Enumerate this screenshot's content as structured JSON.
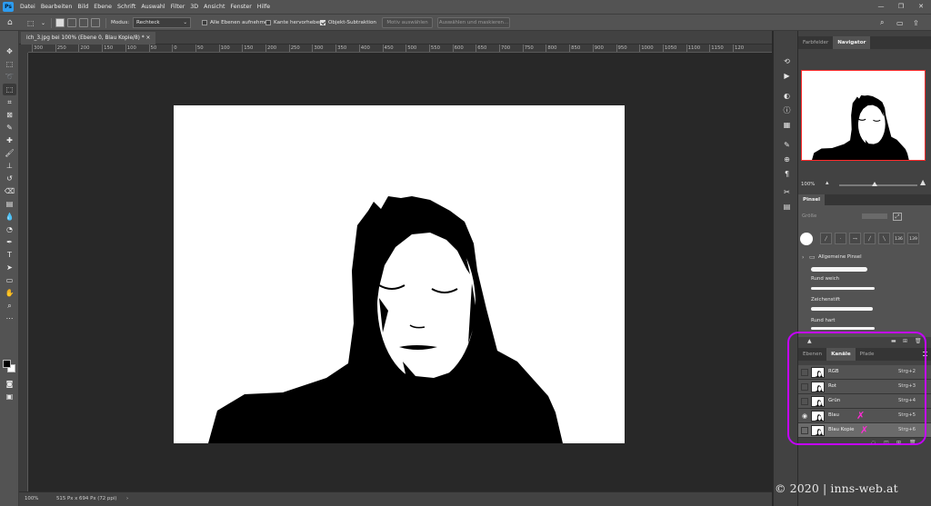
{
  "app": {
    "logo": "Ps"
  },
  "menu": [
    "Datei",
    "Bearbeiten",
    "Bild",
    "Ebene",
    "Schrift",
    "Auswahl",
    "Filter",
    "3D",
    "Ansicht",
    "Fenster",
    "Hilfe"
  ],
  "window_controls": [
    "—",
    "❐",
    "✕"
  ],
  "options_bar": {
    "mode_label": "Modus:",
    "mode_value": "Rechteck",
    "sample_all": "Alle Ebenen aufnehmen",
    "edge_enhance": "Kante hervorheben",
    "object_subtract": "Objekt-Subtraktion",
    "select_subject": "Motiv auswählen",
    "select_mask": "Auswählen und maskieren..."
  },
  "document": {
    "tab_title": "ich_3.jpg bei 100% (Ebene 0, Blau Kopie/8) *",
    "ruler_labels": [
      "300",
      "250",
      "200",
      "150",
      "100",
      "50",
      "0",
      "50",
      "100",
      "150",
      "200",
      "250",
      "300",
      "350",
      "400",
      "450",
      "500",
      "550",
      "600",
      "650",
      "700",
      "750",
      "800",
      "850",
      "900",
      "950",
      "1000",
      "1050",
      "1100",
      "1150",
      "120"
    ],
    "zoom": "100%",
    "status": "515 Px x 694 Px (72 ppi)"
  },
  "navigator": {
    "tabs": [
      "Farbfelder",
      "Navigator"
    ],
    "active_tab": "Navigator",
    "zoom": "100%",
    "zoom_level": 0.45
  },
  "brush_panel": {
    "title": "Pinsel",
    "size_label": "Größe",
    "tip_sizes": [
      "136",
      "139"
    ],
    "group": "Allgemeine Pinsel",
    "brushes": [
      "Rund weich",
      "Zeichenstift",
      "Rund hart"
    ]
  },
  "channels_panel": {
    "tabs": [
      "Ebenen",
      "Kanäle",
      "Pfade"
    ],
    "active_tab": "Kanäle",
    "channels": [
      {
        "name": "RGB",
        "shortcut": "Strg+2",
        "visible": false,
        "selected": false,
        "marked": false
      },
      {
        "name": "Rot",
        "shortcut": "Strg+3",
        "visible": false,
        "selected": false,
        "marked": false
      },
      {
        "name": "Grün",
        "shortcut": "Strg+4",
        "visible": false,
        "selected": false,
        "marked": false
      },
      {
        "name": "Blau",
        "shortcut": "Strg+5",
        "visible": true,
        "selected": false,
        "marked": true
      },
      {
        "name": "Blau Kopie",
        "shortcut": "Strg+6",
        "visible": false,
        "selected": true,
        "marked": true
      }
    ],
    "mark_glyph": "✗",
    "eye_glyph": "◉"
  },
  "watermark": "© 2020 | inns-web.at",
  "colors": {
    "highlight": "#c400ff",
    "mark": "#ff2cd6",
    "nav_frame": "#ff2a2a",
    "foreground": "#000000",
    "background": "#ffffff"
  }
}
